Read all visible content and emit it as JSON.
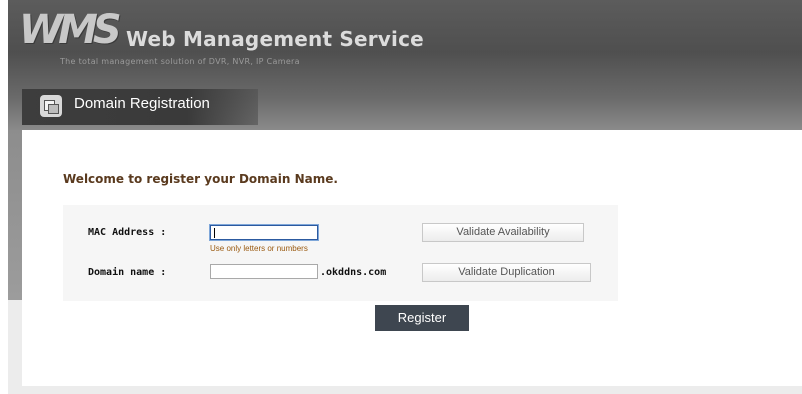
{
  "header": {
    "logo_text": "WMS",
    "brand": "Web Management Service",
    "tagline": "The total management solution of DVR, NVR, IP Camera"
  },
  "tab": {
    "title": "Domain Registration"
  },
  "form": {
    "welcome": "Welcome to register your Domain Name.",
    "mac_label": "MAC Address :",
    "mac_value": "",
    "mac_hint": "Use only letters or numbers",
    "domain_label": "Domain name :",
    "domain_value": "",
    "domain_suffix": ".okddns.com",
    "validate_availability": "Validate Availability",
    "validate_duplication": "Validate Duplication",
    "register": "Register"
  }
}
